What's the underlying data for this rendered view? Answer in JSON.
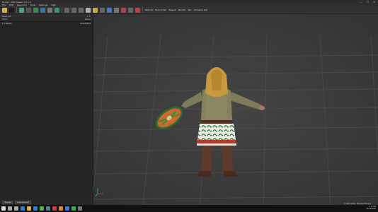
{
  "window": {
    "title": "Noesis - GW Viewer 1.0.1.0",
    "buttons": [
      "—",
      "☐",
      "✕"
    ]
  },
  "menu": [
    "File",
    "Edit",
    "Resource",
    "Tools",
    "Settings",
    "Help"
  ],
  "toolbar": {
    "labels": [
      "Mesh list",
      "Bone limiter",
      "Tangent",
      "Normals",
      "Skin",
      "Animation skip"
    ]
  },
  "panel": {
    "title": "Mesh list",
    "columns": {
      "name": "Name",
      "status": "Status"
    },
    "rows": [
      {
        "name": "▾ 0 (Mesh)",
        "status": "Scene Root"
      }
    ]
  },
  "statusbar": {
    "buttons": [
      "Preview",
      "Load selected"
    ]
  },
  "status_right": "© GW Viewer, Standard Mode ▾",
  "taskbar": {
    "icons": [
      {
        "name": "start-icon",
        "color": "#dddddd"
      },
      {
        "name": "search-taskbar-icon",
        "color": "#aaaaaa"
      },
      {
        "name": "taskview-icon",
        "color": "#aaaaaa"
      },
      {
        "name": "edge-icon",
        "color": "#2d7fd3"
      },
      {
        "name": "explorer-icon",
        "color": "#e0b33a"
      },
      {
        "name": "store-icon",
        "color": "#2d7fd3"
      },
      {
        "name": "chrome-icon",
        "color": "#4caf50"
      },
      {
        "name": "steam-icon",
        "color": "#5a7a9a"
      },
      {
        "name": "app-icon-red",
        "color": "#d13b3b"
      },
      {
        "name": "app-icon-orange",
        "color": "#e0852a"
      },
      {
        "name": "app-icon-blue",
        "color": "#3b7bd1"
      },
      {
        "name": "app-icon-green",
        "color": "#3aa564"
      },
      {
        "name": "noesis-icon",
        "color": "#777777"
      }
    ],
    "clock_time": "3:17 PM",
    "clock_date": "11/12/2020"
  }
}
